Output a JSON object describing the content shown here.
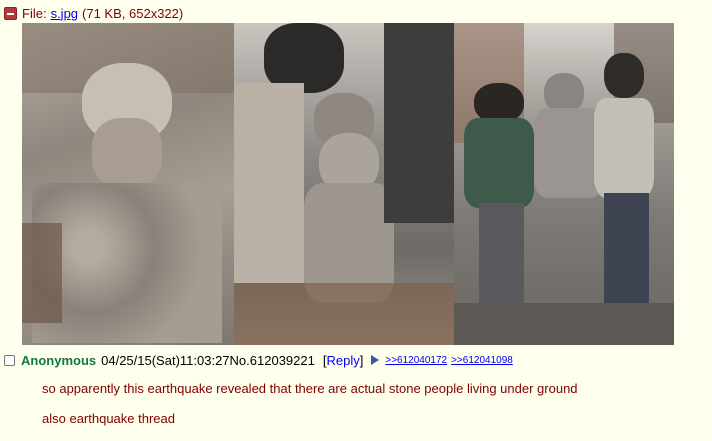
{
  "file": {
    "prefix": "File: ",
    "filename": "s.jpg",
    "meta": "(71 KB, 652x322)"
  },
  "image": {
    "panels": [
      "debris-rubble",
      "man-in-rubble",
      "rescuers-street"
    ]
  },
  "post": {
    "name": "Anonymous",
    "datetime": "04/25/15(Sat)11:03:27",
    "number": "No.612039221",
    "reply_open": "[",
    "reply_label": "Reply",
    "reply_close": "]",
    "backlinks": [
      ">>612040172",
      ">>612041098"
    ],
    "message_lines": [
      "so apparently this earthquake revealed that there are actual stone people living under ground",
      "also earthquake thread"
    ]
  },
  "colors": {
    "background": "#ffffee",
    "name": "#117743",
    "text": "#800000",
    "link": "#0000ee"
  }
}
